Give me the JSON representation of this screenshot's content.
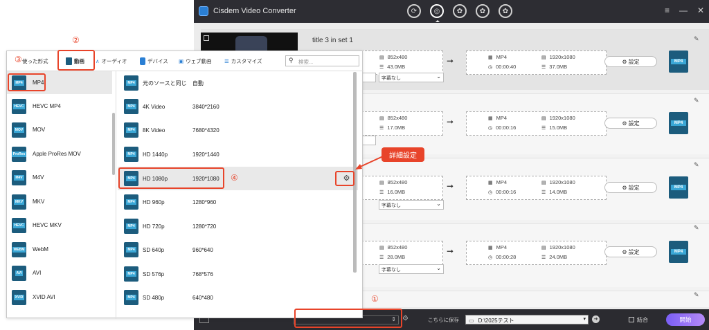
{
  "app": {
    "title": "Cisdem Video Converter",
    "window_controls": [
      "≡",
      "—",
      "✕"
    ],
    "tab_icons": [
      "convert-tab-icon",
      "rip-tab-icon",
      "download-tab-icon",
      "dvd-tab-icon",
      "burn-tab-icon"
    ]
  },
  "rows": [
    {
      "title": "title 3 in set 1",
      "src_res": "852x480",
      "src_size": "43.0MB",
      "out_fmt": "MP4",
      "out_dur": "00:00:40",
      "out_res": "1920x1080",
      "out_size": "37.0MB",
      "settings": "設定",
      "subtitle": "字幕なし",
      "tile": "MP4"
    },
    {
      "title": "",
      "src_res": "852x480",
      "src_size": "17.0MB",
      "out_fmt": "MP4",
      "out_dur": "00:00:16",
      "out_res": "1920x1080",
      "out_size": "15.0MB",
      "settings": "設定",
      "subtitle": "字幕なし",
      "tile": "MP4"
    },
    {
      "title": "",
      "src_res": "852x480",
      "src_size": "16.0MB",
      "out_fmt": "MP4",
      "out_dur": "00:00:16",
      "out_res": "1920x1080",
      "out_size": "14.0MB",
      "settings": "設定",
      "subtitle": "字幕なし",
      "tile": "MP4"
    },
    {
      "title": "",
      "src_res": "852x480",
      "src_size": "28.0MB",
      "out_fmt": "MP4",
      "out_dur": "00:00:28",
      "out_res": "1920x1080",
      "out_size": "24.0MB",
      "settings": "設定",
      "subtitle": "字幕なし",
      "tile": "MP4"
    }
  ],
  "bottom": {
    "save_label": "こちらに保存",
    "path": "D:\\2025テスト",
    "merge": "結合",
    "convert": "開始"
  },
  "dialog": {
    "tabs": [
      {
        "label": "使った形式",
        "color": "#2a7fd4"
      },
      {
        "label": "動画",
        "color": "#1c5c7d"
      },
      {
        "label": "オーディオ",
        "color": "#3a8fd6"
      },
      {
        "label": "デバイス",
        "color": "#2a7fd4"
      },
      {
        "label": "ウェブ動画",
        "color": "#2a7fd4"
      },
      {
        "label": "カスタマイズ",
        "color": "#2a7fd4"
      }
    ],
    "search_placeholder": "検索...",
    "formats": [
      {
        "name": "MP4",
        "icon": "MP4"
      },
      {
        "name": "HEVC MP4",
        "icon": "HEVC"
      },
      {
        "name": "MOV",
        "icon": "MOV"
      },
      {
        "name": "Apple ProRes MOV",
        "icon": "ProRes"
      },
      {
        "name": "M4V",
        "icon": "M4V"
      },
      {
        "name": "MKV",
        "icon": "MKV"
      },
      {
        "name": "HEVC MKV",
        "icon": "HEVC"
      },
      {
        "name": "WebM",
        "icon": "WEBM"
      },
      {
        "name": "AVI",
        "icon": "AVI"
      },
      {
        "name": "XVID AVI",
        "icon": "XVID"
      }
    ],
    "presets": [
      {
        "name": "元のソースと同じ",
        "res": "自動"
      },
      {
        "name": "4K Video",
        "res": "3840*2160"
      },
      {
        "name": "8K Video",
        "res": "7680*4320"
      },
      {
        "name": "HD 1440p",
        "res": "1920*1440"
      },
      {
        "name": "HD 1080p",
        "res": "1920*1080"
      },
      {
        "name": "HD 960p",
        "res": "1280*960"
      },
      {
        "name": "HD 720p",
        "res": "1280*720"
      },
      {
        "name": "SD 640p",
        "res": "960*640"
      },
      {
        "name": "SD 576p",
        "res": "768*576"
      },
      {
        "name": "SD 480p",
        "res": "640*480"
      }
    ],
    "preset_icon": "MP4"
  },
  "annotations": {
    "n1": "①",
    "n2": "②",
    "n3": "③",
    "n4": "④",
    "callout": "詳細設定",
    "color": "#e8442a"
  }
}
